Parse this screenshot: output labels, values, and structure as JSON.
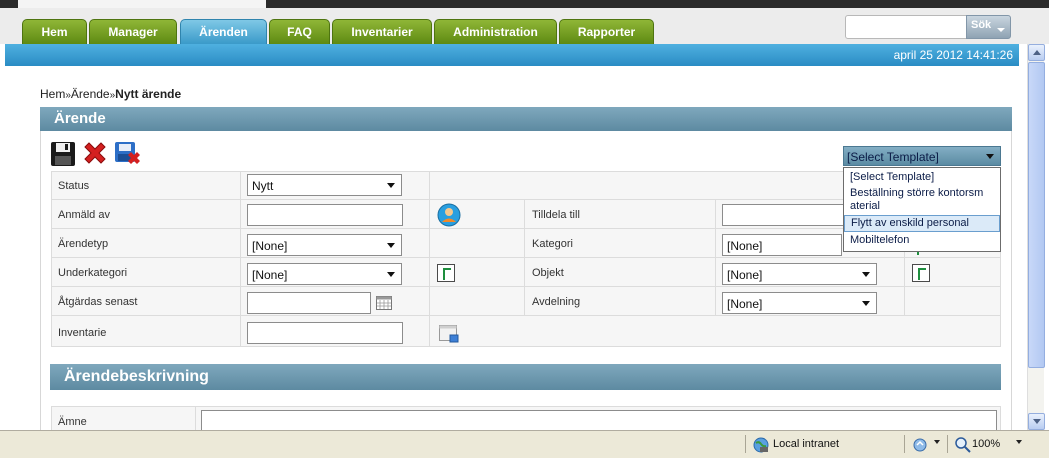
{
  "nav": {
    "tabs": [
      "Hem",
      "Manager",
      "Ärenden",
      "FAQ",
      "Inventarier",
      "Administration",
      "Rapporter"
    ],
    "active_tab": "Ärenden"
  },
  "search": {
    "value": "",
    "button_label": "Sök"
  },
  "datetime": "april 25 2012 14:41:26",
  "breadcrumb": {
    "home": "Hem",
    "sep": "»",
    "parent": "Ärende",
    "current": "Nytt ärende"
  },
  "panel": {
    "title": "Ärende"
  },
  "toolbar": {
    "save_icon": "save-icon",
    "delete_icon": "delete-icon",
    "close_icon": "close-icon"
  },
  "template": {
    "selected": "[Select Template]",
    "options": [
      "[Select Template]",
      "Beställning större kontorsm aterial",
      "Flytt av enskild personal",
      "Mobiltelefon"
    ],
    "highlighted": "Flytt av enskild personal"
  },
  "form": {
    "status": {
      "label": "Status",
      "value": "Nytt"
    },
    "anmald_av": {
      "label": "Anmäld av",
      "value": ""
    },
    "tilldela_till": {
      "label": "Tilldela till",
      "value": ""
    },
    "arendetyp": {
      "label": "Ärendetyp",
      "value": "[None]"
    },
    "kategori": {
      "label": "Kategori",
      "value": "[None]"
    },
    "underkategori": {
      "label": "Underkategori",
      "value": "[None]"
    },
    "objekt": {
      "label": "Objekt",
      "value": "[None]"
    },
    "atgardas": {
      "label": "Åtgärdas senast",
      "value": ""
    },
    "avdelning": {
      "label": "Avdelning",
      "value": "[None]"
    },
    "inventarie": {
      "label": "Inventarie",
      "value": ""
    }
  },
  "section2": {
    "title": "Ärendebeskrivning",
    "amne_label": "Ämne",
    "amne_value": ""
  },
  "statusbar": {
    "zone": "Local intranet",
    "zoom": "100%"
  },
  "colors": {
    "tab_green": "#6e9a1f",
    "tab_active_blue": "#3a9ac9",
    "header_blue": "#2a8cc4",
    "panel_head": "#6c97ad"
  }
}
